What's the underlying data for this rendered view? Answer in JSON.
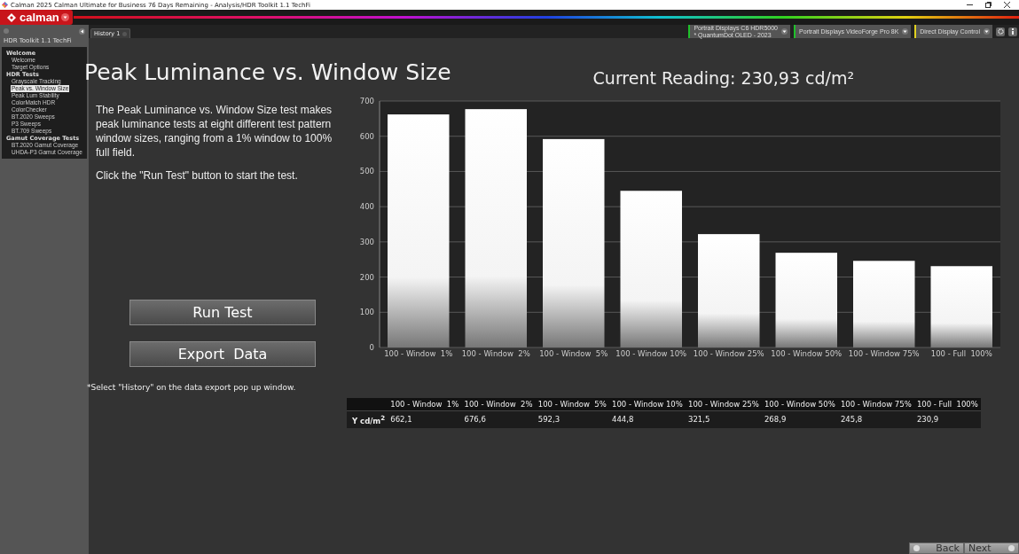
{
  "window": {
    "title": "Calman 2025 Calman Ultimate for Business 76 Days Remaining  - Analysis/HDR Toolkit 1.1 TechFi"
  },
  "app_bar": {
    "logo": "calman"
  },
  "tabs": [
    {
      "label": "History 1",
      "selected": true
    }
  ],
  "devices": [
    {
      "label": "Portrait Displays C6 HDR5000",
      "sublabel": "* QuantumDot OLED - 2023",
      "color": "#1fc02a"
    },
    {
      "label": "Portrait Displays VideoForge Pro 8K",
      "color": "#1fc02a"
    },
    {
      "label": "Direct Display Control",
      "color": "#e0d020"
    }
  ],
  "sidebar": {
    "title": "HDR Toolkit 1.1 TechFi",
    "items": [
      {
        "label": "Welcome",
        "selected": false,
        "children": [
          {
            "label": "Welcome",
            "selected": false
          },
          {
            "label": "Target Options",
            "selected": false
          }
        ]
      },
      {
        "label": "HDR Tests",
        "selected": false,
        "children": [
          {
            "label": "Grayscale Tracking",
            "selected": false
          },
          {
            "label": "Peak vs. Window Size",
            "selected": true
          },
          {
            "label": "Peak Lum Stability",
            "selected": false
          },
          {
            "label": "ColorMatch HDR",
            "selected": false
          },
          {
            "label": "ColorChecker",
            "selected": false
          },
          {
            "label": "BT.2020 Sweeps",
            "selected": false
          },
          {
            "label": "P3 Sweeps",
            "selected": false
          },
          {
            "label": "BT.709 Sweeps",
            "selected": false
          }
        ]
      },
      {
        "label": "Gamut Coverage Tests",
        "selected": false,
        "children": [
          {
            "label": "BT.2020 Gamut Coverage",
            "selected": false
          },
          {
            "label": "UHDA-P3 Gamut Coverage",
            "selected": false
          }
        ]
      }
    ]
  },
  "main": {
    "heading": "Peak Luminance vs. Window Size",
    "reading": "Current Reading: 230,93 cd/m²",
    "description": [
      "The Peak Luminance vs. Window Size test makes peak luminance tests at eight different test pattern window sizes, ranging from a 1% window to 100% full field.",
      "Click the \"Run Test\" button to start the test."
    ],
    "buttons": [
      "Run Test",
      "Export  Data"
    ],
    "footnote": "*Select \"History\" on the data export pop up window.",
    "chart_data": {
      "type": "bar",
      "grid": true,
      "categories": [
        "100 - Window  1%",
        "100 - Window  2%",
        "100 - Window  5%",
        "100 - Window 10%",
        "100 - Window 25%",
        "100 - Window 50%",
        "100 - Window 75%",
        "100 - Full  100%"
      ],
      "values": [
        662,
        677,
        592,
        445,
        322,
        269,
        246,
        231
      ],
      "ylim": [
        0,
        700
      ],
      "yticks": [
        0,
        100,
        200,
        300,
        400,
        500,
        600,
        700
      ]
    },
    "table": {
      "columns": [
        "100 - Window  1%",
        "100 - Window  2%",
        "100 - Window  5%",
        "100 - Window 10%",
        "100 - Window 25%",
        "100 - Window 50%",
        "100 - Window 75%",
        "100 - Full  100%"
      ],
      "row_label": "Y cd/m$^{2}$",
      "cells": [
        "662,1",
        "676,6",
        "592,3",
        "444,8",
        "321,5",
        "268,9",
        "245,8",
        "230,9"
      ]
    },
    "nav": [
      "Back",
      "Next"
    ]
  }
}
